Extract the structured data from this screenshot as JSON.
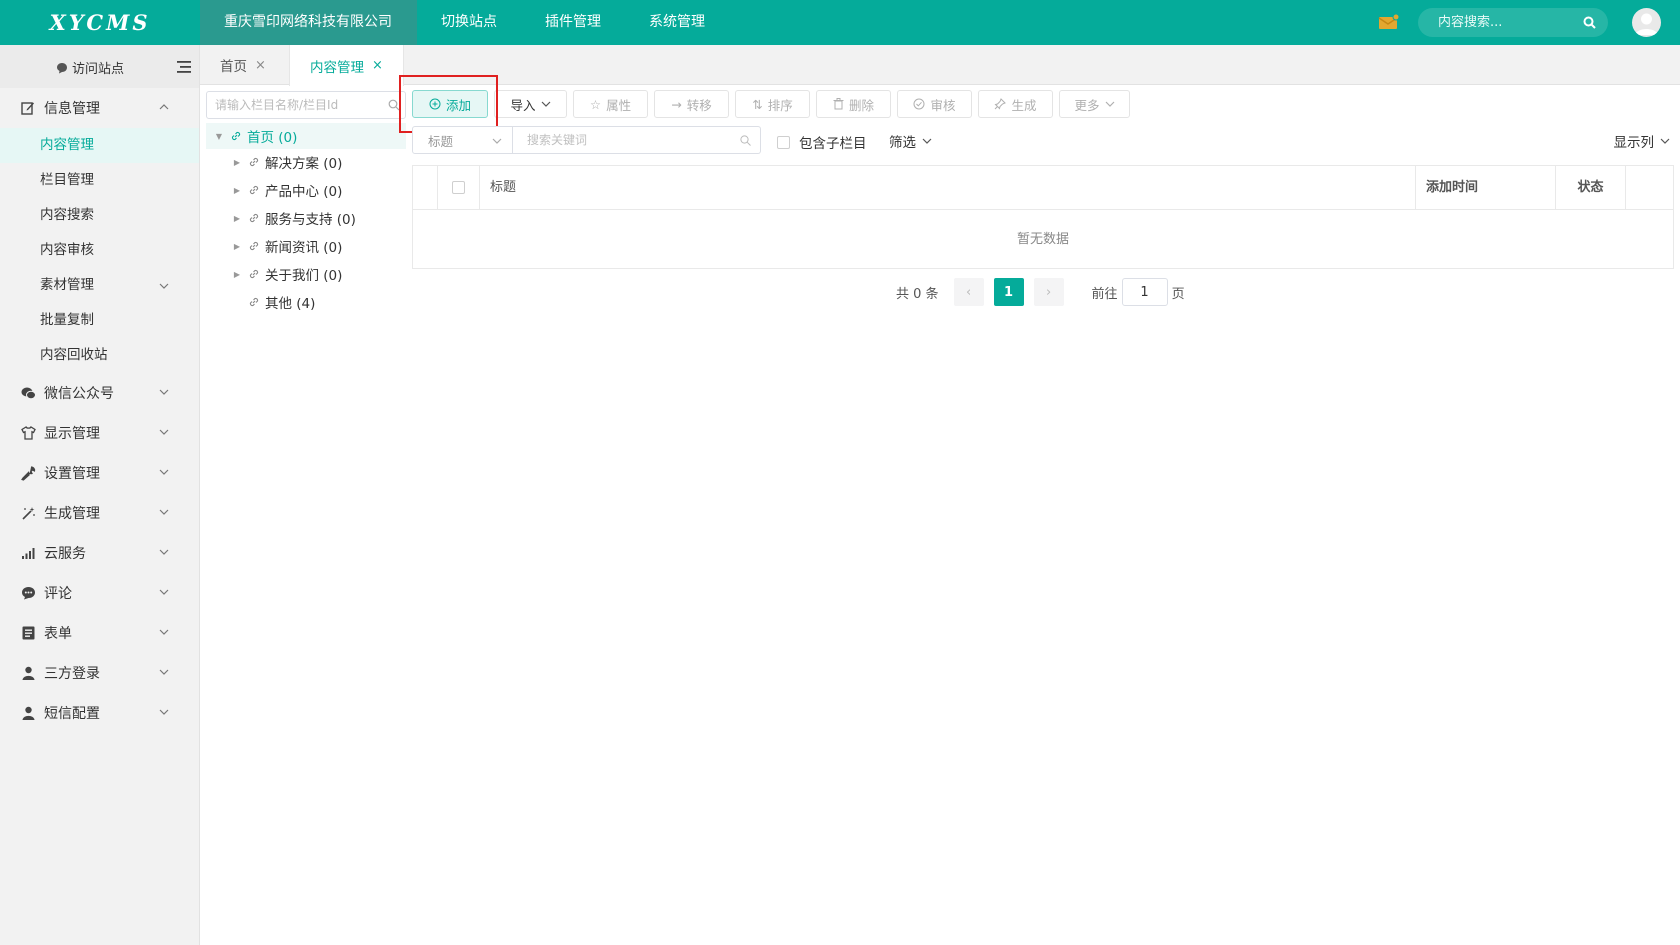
{
  "app": {
    "logo": "XYCMS"
  },
  "topnav": {
    "items": [
      {
        "label": "重庆雪印网络科技有限公司"
      },
      {
        "label": "切换站点"
      },
      {
        "label": "插件管理"
      },
      {
        "label": "系统管理"
      }
    ],
    "search_placeholder": "内容搜索..."
  },
  "sidebar": {
    "visit_site": "访问站点",
    "groups": [
      {
        "label": "信息管理",
        "icon": "edit-icon"
      },
      {
        "label": "微信公众号",
        "icon": "wechat-icon"
      },
      {
        "label": "显示管理",
        "icon": "shirt-icon"
      },
      {
        "label": "设置管理",
        "icon": "wrench-icon"
      },
      {
        "label": "生成管理",
        "icon": "magic-wand-icon"
      },
      {
        "label": "云服务",
        "icon": "signal-icon"
      },
      {
        "label": "评论",
        "icon": "comment-icon"
      },
      {
        "label": "表单",
        "icon": "form-icon"
      },
      {
        "label": "三方登录",
        "icon": "user-icon"
      },
      {
        "label": "短信配置",
        "icon": "user-icon"
      }
    ],
    "sub_items": [
      {
        "label": "内容管理"
      },
      {
        "label": "栏目管理"
      },
      {
        "label": "内容搜索"
      },
      {
        "label": "内容审核"
      },
      {
        "label": "素材管理"
      },
      {
        "label": "批量复制"
      },
      {
        "label": "内容回收站"
      }
    ]
  },
  "tabs": [
    {
      "label": "首页",
      "close": "×"
    },
    {
      "label": "内容管理",
      "close": "×"
    }
  ],
  "tree": {
    "search_placeholder": "请输入栏目名称/栏目Id",
    "nodes": [
      {
        "label": "首页 (0)"
      },
      {
        "label": "解决方案 (0)"
      },
      {
        "label": "产品中心 (0)"
      },
      {
        "label": "服务与支持 (0)"
      },
      {
        "label": "新闻资讯 (0)"
      },
      {
        "label": "关于我们 (0)"
      },
      {
        "label": "其他 (4)"
      }
    ]
  },
  "toolbar": {
    "add": "添加",
    "import": "导入",
    "attr": "属性",
    "move": "转移",
    "sort": "排序",
    "delete": "删除",
    "audit": "审核",
    "generate": "生成",
    "more": "更多"
  },
  "filter": {
    "field": "标题",
    "keyword_placeholder": "搜索关键词",
    "include_sub": "包含子栏目",
    "filter_label": "筛选",
    "columns_label": "显示列"
  },
  "table": {
    "headers": {
      "title": "标题",
      "added": "添加时间",
      "status": "状态"
    },
    "empty": "暂无数据"
  },
  "pager": {
    "total": "共 0 条",
    "current": "1",
    "goto": "前往",
    "goto_value": "1",
    "page": "页",
    "prev": "‹",
    "next": "›"
  },
  "colors": {
    "brand": "#05ab9a",
    "highlight": "#e02020"
  }
}
